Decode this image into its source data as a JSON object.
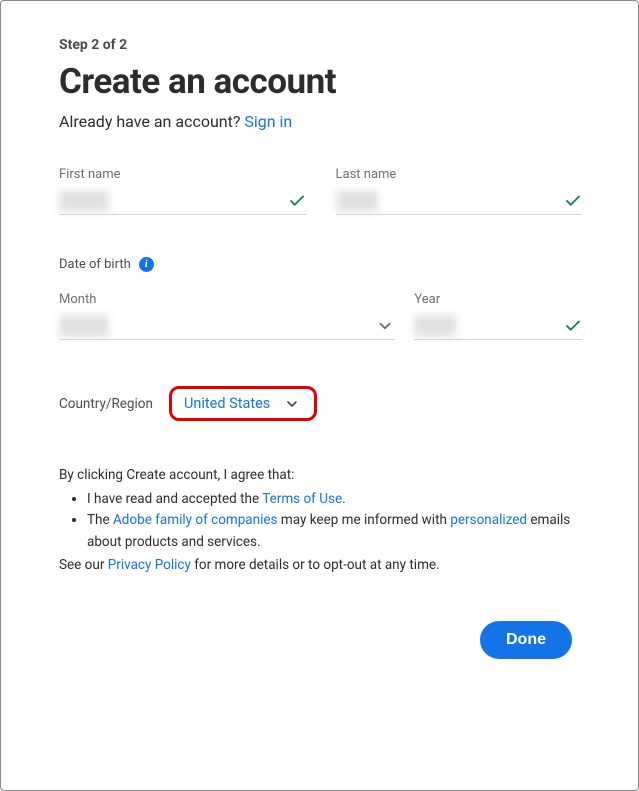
{
  "step": "Step 2 of 2",
  "title": "Create an account",
  "signin_prompt": "Already have an account? ",
  "signin_link": "Sign in",
  "first_name_label": "First name",
  "last_name_label": "Last name",
  "dob_label": "Date of birth",
  "month_label": "Month",
  "year_label": "Year",
  "country_label": "Country/Region",
  "country_value": "United States",
  "agree_intro": "By clicking Create account, I agree that:",
  "agree_item1_pre": "I have read and accepted the ",
  "agree_item1_link": "Terms of Use",
  "agree_item1_post": ".",
  "agree_item2_pre": "The ",
  "agree_item2_link1": "Adobe family of companies",
  "agree_item2_mid": " may keep me informed with ",
  "agree_item2_link2": "personalized",
  "agree_item2_post": " emails about products and services.",
  "agree_footer_pre": "See our ",
  "agree_footer_link": "Privacy Policy",
  "agree_footer_post": " for more details or to opt-out at any time.",
  "done_label": "Done"
}
